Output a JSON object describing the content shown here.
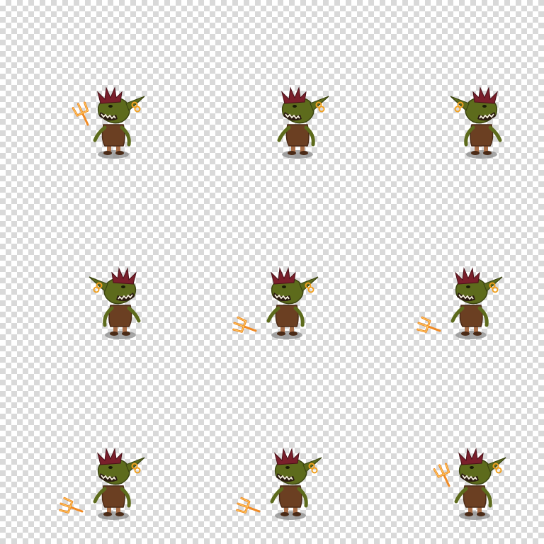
{
  "sprite_sheet": {
    "grid": {
      "rows": 3,
      "columns": 3
    },
    "character": "goblin",
    "colors": {
      "skin": "#5d6b1c",
      "skin_dark": "#3b4410",
      "mohawk": "#7a1f2b",
      "earring": "#f0a020",
      "robe": "#6b3f22",
      "robe_dark": "#4a2a16",
      "legs": "#a86e48",
      "teeth": "#f4efdc",
      "fork": "#f08a24",
      "fork_glow": "#ffd36a",
      "shadow": "#8a8a8a"
    },
    "frames": [
      {
        "row": 1,
        "col": 1,
        "facing": "left",
        "weapon": "trident",
        "weapon_side": "left",
        "pose": "idle"
      },
      {
        "row": 1,
        "col": 2,
        "facing": "left",
        "weapon": "trident",
        "weapon_side": "hidden",
        "pose": "idle"
      },
      {
        "row": 1,
        "col": 3,
        "facing": "right",
        "weapon": "none",
        "weapon_side": "none",
        "pose": "idle"
      },
      {
        "row": 2,
        "col": 1,
        "facing": "right",
        "weapon": "none",
        "weapon_side": "none",
        "pose": "idle"
      },
      {
        "row": 2,
        "col": 2,
        "facing": "left",
        "weapon": "trident",
        "weapon_side": "low-left",
        "pose": "attack"
      },
      {
        "row": 2,
        "col": 3,
        "facing": "left",
        "weapon": "trident",
        "weapon_side": "low-left",
        "pose": "attack"
      },
      {
        "row": 3,
        "col": 1,
        "facing": "left",
        "weapon": "trident",
        "weapon_side": "low-left",
        "pose": "attack"
      },
      {
        "row": 3,
        "col": 2,
        "facing": "left",
        "weapon": "trident",
        "weapon_side": "low-left",
        "pose": "attack"
      },
      {
        "row": 3,
        "col": 3,
        "facing": "left",
        "weapon": "trident",
        "weapon_side": "left",
        "pose": "attack"
      }
    ]
  }
}
